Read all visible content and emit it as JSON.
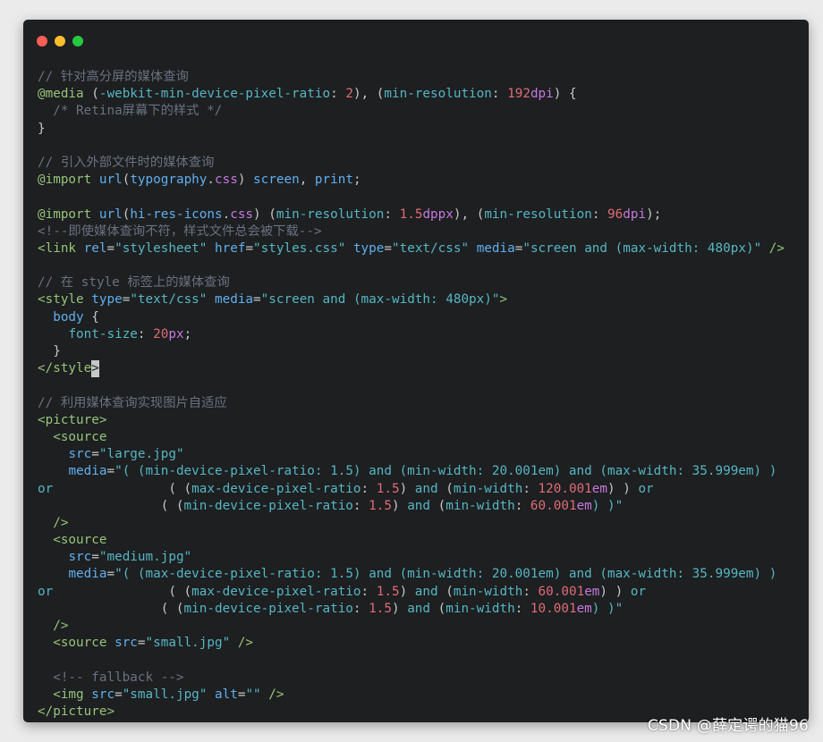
{
  "window": {
    "title_dots": [
      "close",
      "minimize",
      "maximize"
    ]
  },
  "watermark": "CSDN @薛定谔的猫96",
  "colors": {
    "background": "#1d1f21",
    "comment": "#6a7280",
    "keyword": "#98c379",
    "function": "#61afef",
    "property": "#56b6c2",
    "number": "#e06c75"
  },
  "code": {
    "lines": [
      [
        {
          "t": "// 针对高分屏的媒体查询",
          "c": "c"
        }
      ],
      [
        {
          "t": "@media",
          "c": "kw"
        },
        {
          "t": " (",
          "c": ""
        },
        {
          "t": "-webkit-min-device-pixel-ratio",
          "c": "pr"
        },
        {
          "t": ": ",
          "c": ""
        },
        {
          "t": "2",
          "c": "nu"
        },
        {
          "t": "), (",
          "c": ""
        },
        {
          "t": "min-resolution",
          "c": "pr"
        },
        {
          "t": ": ",
          "c": ""
        },
        {
          "t": "192",
          "c": "nu"
        },
        {
          "t": "dpi",
          "c": "un"
        },
        {
          "t": ") {",
          "c": ""
        }
      ],
      [
        {
          "t": "  /* Retina屏幕下的样式 */",
          "c": "c"
        }
      ],
      [
        {
          "t": "}",
          "c": ""
        }
      ],
      [
        {
          "t": "",
          "c": ""
        }
      ],
      [
        {
          "t": "// 引入外部文件时的媒体查询",
          "c": "c"
        }
      ],
      [
        {
          "t": "@import",
          "c": "kw"
        },
        {
          "t": " ",
          "c": ""
        },
        {
          "t": "url",
          "c": "fn"
        },
        {
          "t": "(",
          "c": ""
        },
        {
          "t": "typography",
          "c": "fn"
        },
        {
          "t": ".",
          "c": ""
        },
        {
          "t": "css",
          "c": "un"
        },
        {
          "t": ") ",
          "c": ""
        },
        {
          "t": "screen",
          "c": "fn"
        },
        {
          "t": ", ",
          "c": ""
        },
        {
          "t": "print",
          "c": "fn"
        },
        {
          "t": ";",
          "c": ""
        }
      ],
      [
        {
          "t": "",
          "c": ""
        }
      ],
      [
        {
          "t": "@import",
          "c": "kw"
        },
        {
          "t": " ",
          "c": ""
        },
        {
          "t": "url",
          "c": "fn"
        },
        {
          "t": "(",
          "c": ""
        },
        {
          "t": "hi-res-icons",
          "c": "fn"
        },
        {
          "t": ".",
          "c": ""
        },
        {
          "t": "css",
          "c": "un"
        },
        {
          "t": ") (",
          "c": ""
        },
        {
          "t": "min-resolution",
          "c": "pr"
        },
        {
          "t": ": ",
          "c": ""
        },
        {
          "t": "1.5",
          "c": "nu"
        },
        {
          "t": "dppx",
          "c": "un"
        },
        {
          "t": "), (",
          "c": ""
        },
        {
          "t": "min-resolution",
          "c": "pr"
        },
        {
          "t": ": ",
          "c": ""
        },
        {
          "t": "96",
          "c": "nu"
        },
        {
          "t": "dpi",
          "c": "un"
        },
        {
          "t": ");",
          "c": ""
        }
      ],
      [
        {
          "t": "<!--即使媒体查询不符，样式文件总会被下载-->",
          "c": "c"
        }
      ],
      [
        {
          "t": "<link",
          "c": "tg"
        },
        {
          "t": " ",
          "c": ""
        },
        {
          "t": "rel",
          "c": "at"
        },
        {
          "t": "=",
          "c": ""
        },
        {
          "t": "\"stylesheet\"",
          "c": "st"
        },
        {
          "t": " ",
          "c": ""
        },
        {
          "t": "href",
          "c": "at"
        },
        {
          "t": "=",
          "c": ""
        },
        {
          "t": "\"styles.css\"",
          "c": "st"
        },
        {
          "t": " ",
          "c": ""
        },
        {
          "t": "type",
          "c": "at"
        },
        {
          "t": "=",
          "c": ""
        },
        {
          "t": "\"text/css\"",
          "c": "st"
        },
        {
          "t": " ",
          "c": ""
        },
        {
          "t": "media",
          "c": "at"
        },
        {
          "t": "=",
          "c": ""
        },
        {
          "t": "\"screen and (max-width: 480px)\"",
          "c": "st"
        },
        {
          "t": " ",
          "c": ""
        },
        {
          "t": "/>",
          "c": "tg"
        }
      ],
      [
        {
          "t": "",
          "c": ""
        }
      ],
      [
        {
          "t": "// 在 style 标签上的媒体查询",
          "c": "c"
        }
      ],
      [
        {
          "t": "<style",
          "c": "tg"
        },
        {
          "t": " ",
          "c": ""
        },
        {
          "t": "type",
          "c": "at"
        },
        {
          "t": "=",
          "c": ""
        },
        {
          "t": "\"text/css\"",
          "c": "st"
        },
        {
          "t": " ",
          "c": ""
        },
        {
          "t": "media",
          "c": "at"
        },
        {
          "t": "=",
          "c": ""
        },
        {
          "t": "\"screen and (max-width: 480px)\"",
          "c": "st"
        },
        {
          "t": ">",
          "c": "tg"
        }
      ],
      [
        {
          "t": "  ",
          "c": ""
        },
        {
          "t": "body",
          "c": "fn"
        },
        {
          "t": " {",
          "c": ""
        }
      ],
      [
        {
          "t": "    ",
          "c": ""
        },
        {
          "t": "font-size",
          "c": "pr"
        },
        {
          "t": ": ",
          "c": ""
        },
        {
          "t": "20",
          "c": "nu"
        },
        {
          "t": "px",
          "c": "un"
        },
        {
          "t": ";",
          "c": ""
        }
      ],
      [
        {
          "t": "  }",
          "c": ""
        }
      ],
      [
        {
          "t": "</style",
          "c": "tg"
        },
        {
          "t": ">",
          "c": "cursor"
        }
      ],
      [
        {
          "t": "",
          "c": ""
        }
      ],
      [
        {
          "t": "// 利用媒体查询实现图片自适应",
          "c": "c"
        }
      ],
      [
        {
          "t": "<picture>",
          "c": "tg"
        }
      ],
      [
        {
          "t": "  ",
          "c": ""
        },
        {
          "t": "<source",
          "c": "tg"
        }
      ],
      [
        {
          "t": "    ",
          "c": ""
        },
        {
          "t": "src",
          "c": "at"
        },
        {
          "t": "=",
          "c": ""
        },
        {
          "t": "\"large.jpg\"",
          "c": "st"
        }
      ],
      [
        {
          "t": "    ",
          "c": ""
        },
        {
          "t": "media",
          "c": "at"
        },
        {
          "t": "=",
          "c": ""
        },
        {
          "t": "\"( (min-device-pixel-ratio: 1.5) and (min-width: 20.001em) and (max-width: 35.999em) )",
          "c": "st"
        }
      ],
      [
        {
          "t": "or",
          "c": "st"
        },
        {
          "t": "               ( (",
          "c": ""
        },
        {
          "t": "max-device-pixel-ratio",
          "c": "pr"
        },
        {
          "t": ": ",
          "c": ""
        },
        {
          "t": "1.5",
          "c": "nu"
        },
        {
          "t": ") ",
          "c": ""
        },
        {
          "t": "and",
          "c": "st"
        },
        {
          "t": " (",
          "c": ""
        },
        {
          "t": "min-width",
          "c": "pr"
        },
        {
          "t": ": ",
          "c": ""
        },
        {
          "t": "120.001",
          "c": "nu"
        },
        {
          "t": "em",
          "c": "un"
        },
        {
          "t": ") ) ",
          "c": ""
        },
        {
          "t": "or",
          "c": "st"
        }
      ],
      [
        {
          "t": "                ( (",
          "c": ""
        },
        {
          "t": "min-device-pixel-ratio",
          "c": "pr"
        },
        {
          "t": ": ",
          "c": ""
        },
        {
          "t": "1.5",
          "c": "nu"
        },
        {
          "t": ") ",
          "c": ""
        },
        {
          "t": "and",
          "c": "st"
        },
        {
          "t": " (",
          "c": ""
        },
        {
          "t": "min-width",
          "c": "pr"
        },
        {
          "t": ": ",
          "c": ""
        },
        {
          "t": "60.001",
          "c": "nu"
        },
        {
          "t": "em",
          "c": "un"
        },
        {
          "t": ") )\"",
          "c": "st"
        }
      ],
      [
        {
          "t": "  ",
          "c": ""
        },
        {
          "t": "/>",
          "c": "tg"
        }
      ],
      [
        {
          "t": "  ",
          "c": ""
        },
        {
          "t": "<source",
          "c": "tg"
        }
      ],
      [
        {
          "t": "    ",
          "c": ""
        },
        {
          "t": "src",
          "c": "at"
        },
        {
          "t": "=",
          "c": ""
        },
        {
          "t": "\"medium.jpg\"",
          "c": "st"
        }
      ],
      [
        {
          "t": "    ",
          "c": ""
        },
        {
          "t": "media",
          "c": "at"
        },
        {
          "t": "=",
          "c": ""
        },
        {
          "t": "\"( (max-device-pixel-ratio: 1.5) and (min-width: 20.001em) and (max-width: 35.999em) )",
          "c": "st"
        }
      ],
      [
        {
          "t": "or",
          "c": "st"
        },
        {
          "t": "               ( (",
          "c": ""
        },
        {
          "t": "max-device-pixel-ratio",
          "c": "pr"
        },
        {
          "t": ": ",
          "c": ""
        },
        {
          "t": "1.5",
          "c": "nu"
        },
        {
          "t": ") ",
          "c": ""
        },
        {
          "t": "and",
          "c": "st"
        },
        {
          "t": " (",
          "c": ""
        },
        {
          "t": "min-width",
          "c": "pr"
        },
        {
          "t": ": ",
          "c": ""
        },
        {
          "t": "60.001",
          "c": "nu"
        },
        {
          "t": "em",
          "c": "un"
        },
        {
          "t": ") ) ",
          "c": ""
        },
        {
          "t": "or",
          "c": "st"
        }
      ],
      [
        {
          "t": "                ( (",
          "c": ""
        },
        {
          "t": "min-device-pixel-ratio",
          "c": "pr"
        },
        {
          "t": ": ",
          "c": ""
        },
        {
          "t": "1.5",
          "c": "nu"
        },
        {
          "t": ") ",
          "c": ""
        },
        {
          "t": "and",
          "c": "st"
        },
        {
          "t": " (",
          "c": ""
        },
        {
          "t": "min-width",
          "c": "pr"
        },
        {
          "t": ": ",
          "c": ""
        },
        {
          "t": "10.001",
          "c": "nu"
        },
        {
          "t": "em",
          "c": "un"
        },
        {
          "t": ") )\"",
          "c": "st"
        }
      ],
      [
        {
          "t": "  ",
          "c": ""
        },
        {
          "t": "/>",
          "c": "tg"
        }
      ],
      [
        {
          "t": "  ",
          "c": ""
        },
        {
          "t": "<source",
          "c": "tg"
        },
        {
          "t": " ",
          "c": ""
        },
        {
          "t": "src",
          "c": "at"
        },
        {
          "t": "=",
          "c": ""
        },
        {
          "t": "\"small.jpg\"",
          "c": "st"
        },
        {
          "t": " ",
          "c": ""
        },
        {
          "t": "/>",
          "c": "tg"
        }
      ],
      [
        {
          "t": "",
          "c": ""
        }
      ],
      [
        {
          "t": "  <!-- fallback -->",
          "c": "c"
        }
      ],
      [
        {
          "t": "  ",
          "c": ""
        },
        {
          "t": "<img",
          "c": "tg"
        },
        {
          "t": " ",
          "c": ""
        },
        {
          "t": "src",
          "c": "at"
        },
        {
          "t": "=",
          "c": ""
        },
        {
          "t": "\"small.jpg\"",
          "c": "st"
        },
        {
          "t": " ",
          "c": ""
        },
        {
          "t": "alt",
          "c": "at"
        },
        {
          "t": "=",
          "c": ""
        },
        {
          "t": "\"\"",
          "c": "st"
        },
        {
          "t": " ",
          "c": ""
        },
        {
          "t": "/>",
          "c": "tg"
        }
      ],
      [
        {
          "t": "</picture>",
          "c": "tg"
        }
      ]
    ]
  }
}
